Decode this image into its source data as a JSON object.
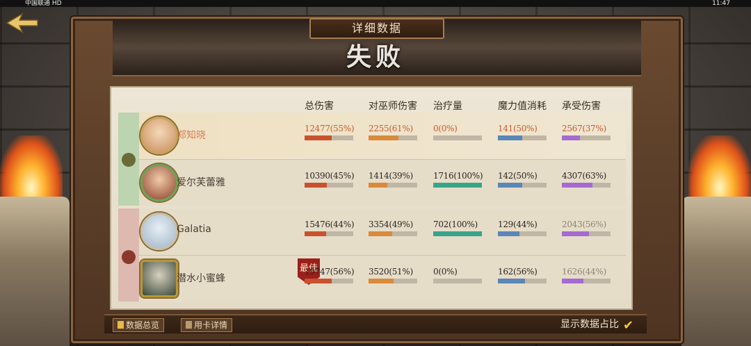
{
  "status_bar": {
    "left": "中国联通 HD",
    "right": "11:47"
  },
  "title": "详细数据",
  "result": "失败",
  "headers": [
    "总伤害",
    "对巫师伤害",
    "治疗量",
    "魔力值消耗",
    "承受伤害"
  ],
  "colors": {
    "damage": "#c9522e",
    "hunter_damage": "#d98a3a",
    "heal": "#3aa48a",
    "mana": "#5a86b8",
    "taken": "#a66ad0"
  },
  "teams": [
    {
      "side": "win",
      "players": [
        {
          "name": "郑知晓",
          "me": true,
          "stats": [
            {
              "text": "12477(55%)",
              "pct": 55
            },
            {
              "text": "2255(61%)",
              "pct": 61
            },
            {
              "text": "0(0%)",
              "pct": 0
            },
            {
              "text": "141(50%)",
              "pct": 50
            },
            {
              "text": "2567(37%)",
              "pct": 37
            }
          ]
        },
        {
          "name": "爱尔芙蕾雅",
          "me": false,
          "stats": [
            {
              "text": "10390(45%)",
              "pct": 45
            },
            {
              "text": "1414(39%)",
              "pct": 39
            },
            {
              "text": "1716(100%)",
              "pct": 100
            },
            {
              "text": "142(50%)",
              "pct": 50
            },
            {
              "text": "4307(63%)",
              "pct": 63
            }
          ]
        }
      ]
    },
    {
      "side": "lose",
      "players": [
        {
          "name": "Galatia",
          "me": false,
          "stats": [
            {
              "text": "15476(44%)",
              "pct": 44
            },
            {
              "text": "3354(49%)",
              "pct": 49
            },
            {
              "text": "702(100%)",
              "pct": 100
            },
            {
              "text": "129(44%)",
              "pct": 44
            },
            {
              "text": "2043(56%)",
              "pct": 56
            }
          ]
        },
        {
          "name": "潜水小蜜蜂",
          "me": false,
          "best": "最佳",
          "stats": [
            {
              "text": "19747(56%)",
              "pct": 56
            },
            {
              "text": "3520(51%)",
              "pct": 51
            },
            {
              "text": "0(0%)",
              "pct": 0
            },
            {
              "text": "162(56%)",
              "pct": 56
            },
            {
              "text": "1626(44%)",
              "pct": 44
            }
          ]
        }
      ]
    }
  ],
  "bottom": {
    "overview": "数据总览",
    "card_details": "用卡详情",
    "show_ratio": "显示数据占比",
    "show_ratio_checked": true
  }
}
